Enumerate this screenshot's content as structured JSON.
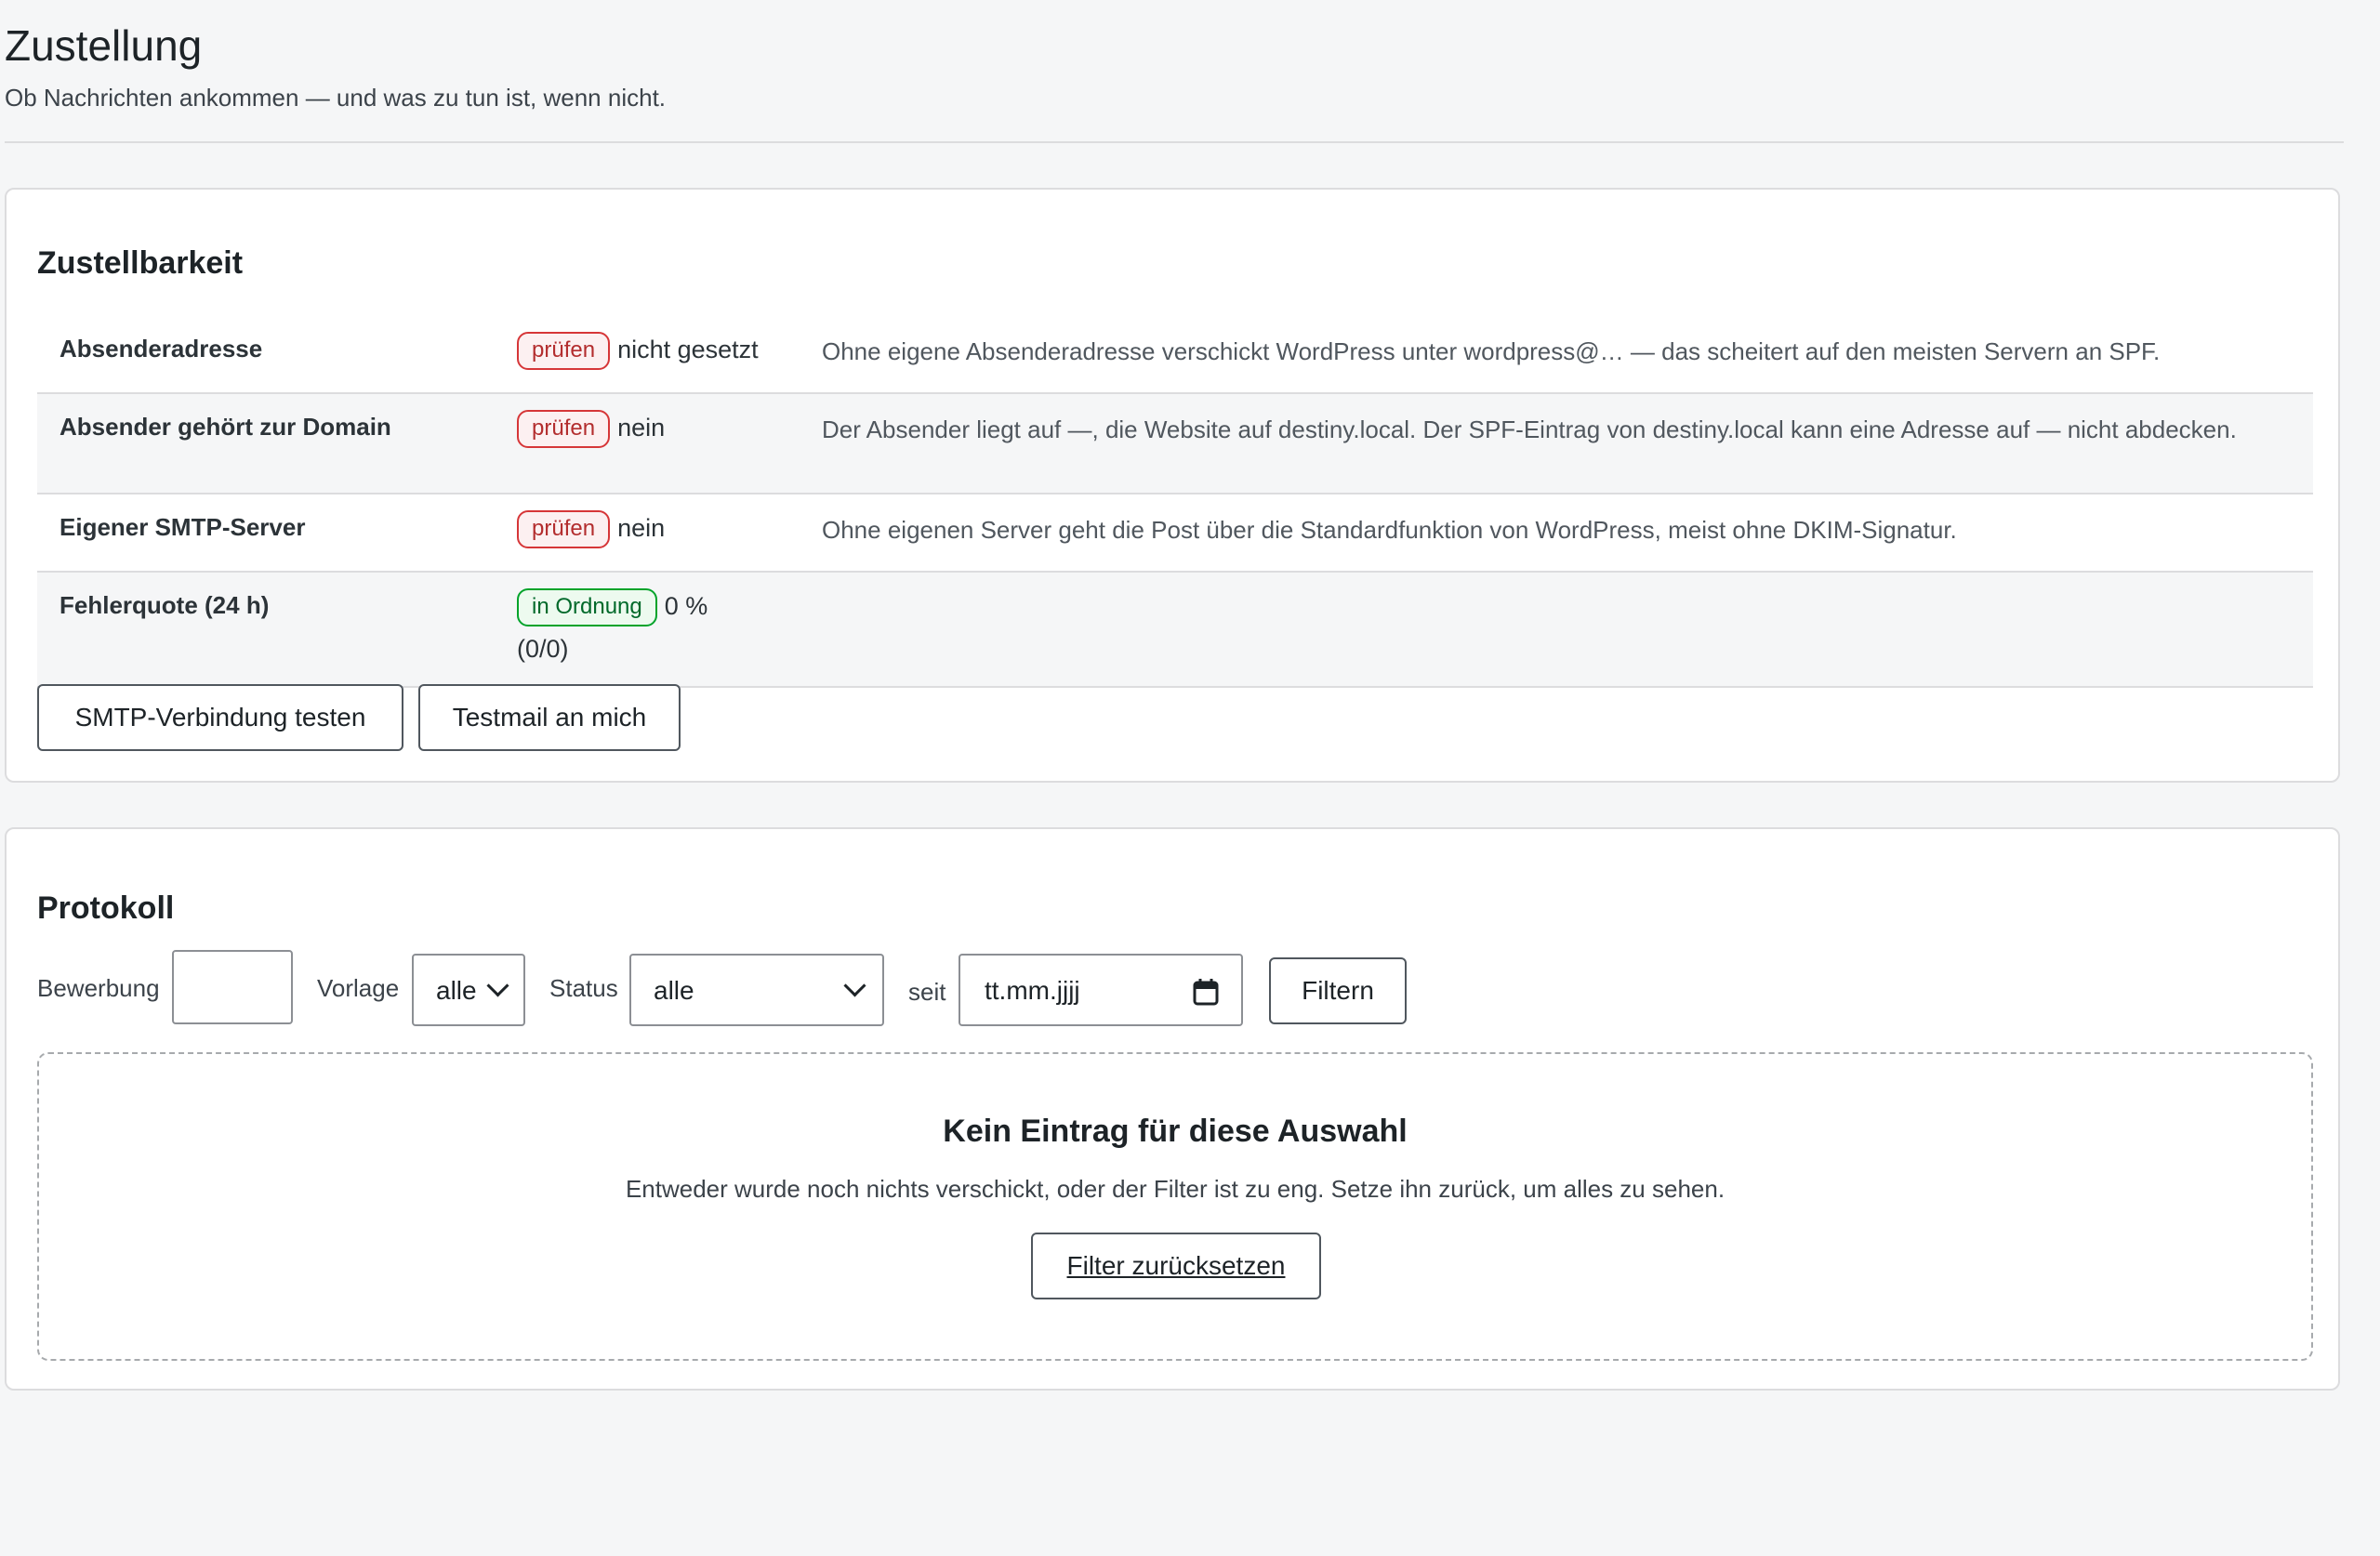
{
  "header": {
    "title": "Zustellung",
    "subtitle": "Ob Nachrichten ankommen — und was zu tun ist, wenn nicht."
  },
  "deliverability": {
    "title": "Zustellbarkeit",
    "rows": [
      {
        "label": "Absenderadresse",
        "badge": "prüfen",
        "badge_type": "warning",
        "value": "nicht gesetzt",
        "note": "Ohne eigene Absenderadresse verschickt WordPress unter wordpress@… — das scheitert auf den meisten Servern an SPF."
      },
      {
        "label": "Absender gehört zur Domain",
        "badge": "prüfen",
        "badge_type": "warning",
        "value": "nein",
        "note": "Der Absender liegt auf —, die Website auf destiny.local. Der SPF-Eintrag von destiny.local kann eine Adresse auf — nicht abdecken."
      },
      {
        "label": "Eigener SMTP-Server",
        "badge": "prüfen",
        "badge_type": "warning",
        "value": "nein",
        "note": "Ohne eigenen Server geht die Post über die Standardfunktion von WordPress, meist ohne DKIM-Signatur."
      },
      {
        "label": "Fehlerquote (24 h)",
        "badge": "in Ordnung",
        "badge_type": "ok",
        "value": "0 %",
        "value2": "(0/0)",
        "note": ""
      }
    ],
    "buttons": {
      "smtp_test": "SMTP-Verbindung testen",
      "testmail": "Testmail an mich"
    }
  },
  "log": {
    "title": "Protokoll",
    "filters": {
      "application_label": "Bewerbung",
      "application_value": "",
      "template_label": "Vorlage",
      "template_value": "alle",
      "status_label": "Status",
      "status_value": "alle",
      "since_label": "seit",
      "since_placeholder": "tt.mm.jjjj",
      "filter_button": "Filtern"
    },
    "empty": {
      "title": "Kein Eintrag für diese Auswahl",
      "text": "Entweder wurde noch nichts verschickt, oder der Filter ist zu eng. Setze ihn zurück, um alles zu sehen.",
      "reset_button": "Filter zurücksetzen"
    }
  },
  "colors": {
    "badge_warning": "#d63638",
    "badge_ok": "#00a32a",
    "background": "#f5f6f7"
  }
}
